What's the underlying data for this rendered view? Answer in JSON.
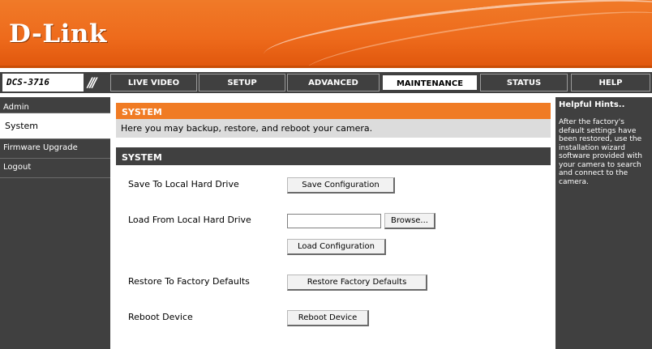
{
  "brand": {
    "logo": "D-Link"
  },
  "nav": {
    "model": "DCS-3716",
    "slashes": "///",
    "tabs": [
      {
        "label": "LIVE VIDEO"
      },
      {
        "label": "SETUP"
      },
      {
        "label": "ADVANCED"
      },
      {
        "label": "MAINTENANCE"
      },
      {
        "label": "STATUS"
      },
      {
        "label": "HELP"
      }
    ],
    "active_tab": "MAINTENANCE"
  },
  "sidebar": {
    "items": [
      {
        "label": "Admin"
      },
      {
        "label": "System"
      },
      {
        "label": "Firmware Upgrade"
      },
      {
        "label": "Logout"
      }
    ],
    "active_item": "System"
  },
  "main": {
    "title": "SYSTEM",
    "description": "Here you may backup, restore, and reboot your camera.",
    "section_title": "SYSTEM",
    "rows": {
      "save_label": "Save To Local Hard Drive",
      "save_button": "Save Configuration",
      "load_label": "Load From Local Hard Drive",
      "file_value": "",
      "browse_button": "Browse...",
      "load_button": "Load Configuration",
      "restore_label": "Restore To Factory Defaults",
      "restore_button": "Restore Factory Defaults",
      "reboot_label": "Reboot Device",
      "reboot_button": "Reboot Device"
    }
  },
  "hints": {
    "title": "Helpful Hints..",
    "text": "After the factory's default settings have been restored, use the installation wizard software provided with your camera to search and connect to the camera."
  },
  "colors": {
    "accent_orange": "#f07b24",
    "dark_gray": "#404040",
    "light_gray": "#dcdcdc"
  }
}
